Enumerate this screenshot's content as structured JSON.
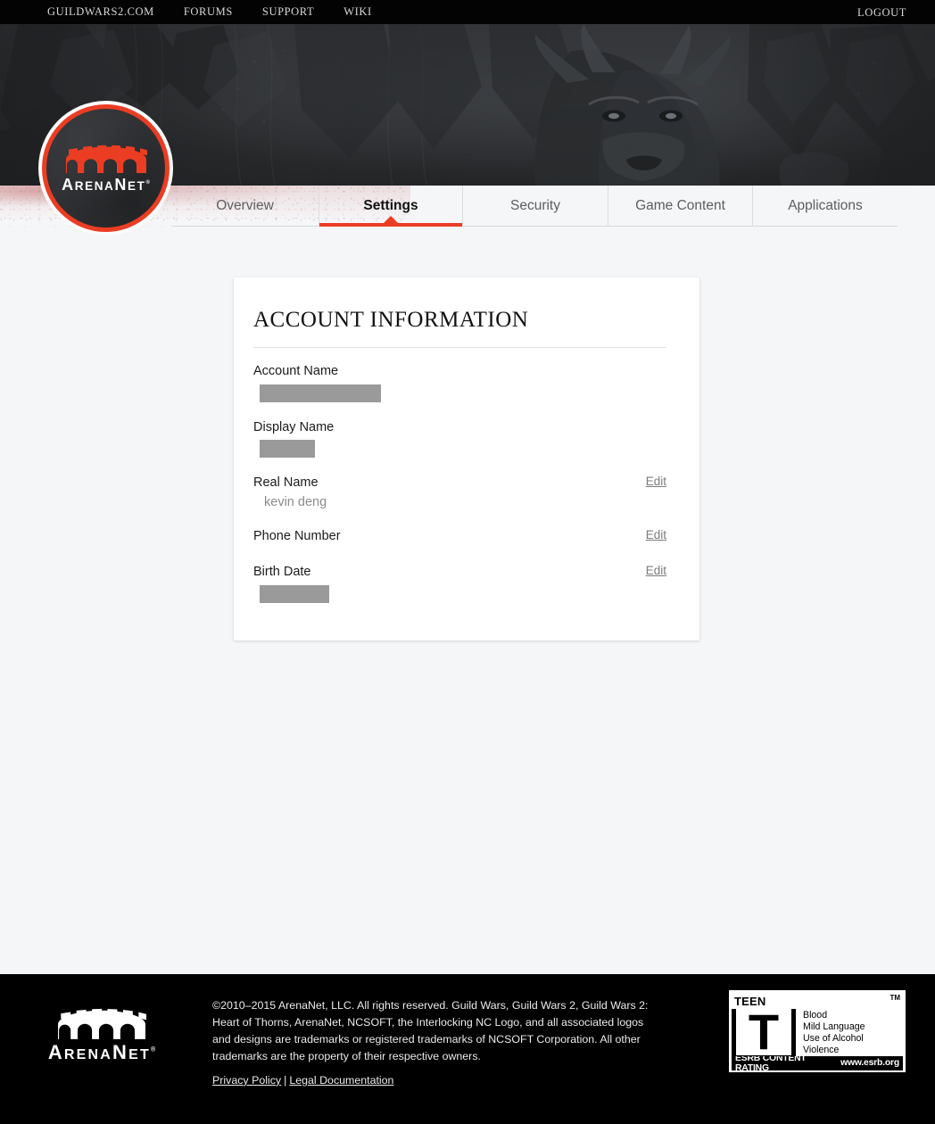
{
  "topnav": {
    "links": [
      {
        "label": "GUILDWARS2.COM",
        "name": "nav-link-guildwars2"
      },
      {
        "label": "FORUMS",
        "name": "nav-link-forums"
      },
      {
        "label": "SUPPORT",
        "name": "nav-link-support"
      },
      {
        "label": "WIKI",
        "name": "nav-link-wiki"
      }
    ],
    "logout_label": "LOGOUT"
  },
  "brand": {
    "name_upper": "A",
    "full": "ARENANET",
    "parts": {
      "a": "A",
      "rena": "RENA",
      "n": "N",
      "et": "ET"
    },
    "trademark": "®",
    "accent_color": "#eb3d23"
  },
  "tabs": [
    {
      "label": "Overview",
      "active": false,
      "name": "tab-overview"
    },
    {
      "label": "Settings",
      "active": true,
      "name": "tab-settings"
    },
    {
      "label": "Security",
      "active": false,
      "name": "tab-security"
    },
    {
      "label": "Game Content",
      "active": false,
      "name": "tab-game-content"
    },
    {
      "label": "Applications",
      "active": false,
      "name": "tab-applications"
    }
  ],
  "card": {
    "title": "ACCOUNT INFORMATION",
    "fields": [
      {
        "label": "Account Name",
        "value": "",
        "redacted": true,
        "edit": false,
        "edit_label": ""
      },
      {
        "label": "Display Name",
        "value": "",
        "redacted": true,
        "edit": false,
        "edit_label": ""
      },
      {
        "label": "Real Name",
        "value": "kevin deng",
        "redacted": false,
        "edit": true,
        "edit_label": "Edit"
      },
      {
        "label": "Phone Number",
        "value": "",
        "redacted": false,
        "edit": true,
        "edit_label": "Edit"
      },
      {
        "label": "Birth Date",
        "value": "",
        "redacted": true,
        "edit": true,
        "edit_label": "Edit"
      }
    ]
  },
  "footer": {
    "copyright": "©2010–2015 ArenaNet, LLC. All rights reserved. Guild Wars, Guild Wars 2, Guild Wars 2: Heart of Thorns, ArenaNet, NCSOFT, the Interlocking NC Logo, and all associated logos and designs are trademarks or registered trademarks of NCSOFT Corporation. All other trademarks are the property of their respective owners.",
    "privacy_label": "Privacy Policy",
    "separator": "|",
    "legal_label": "Legal Documentation"
  },
  "esrb": {
    "rating_word": "TEEN",
    "rating_letter": "T",
    "tm": "TM",
    "descriptors": [
      "Blood",
      "Mild Language",
      "Use of Alcohol",
      "Violence"
    ],
    "footer_left": "ESRB CONTENT RATING",
    "footer_right": "www.esrb.org"
  },
  "colors": {
    "accent": "#eb3d23",
    "page_bg": "#f5f6f8",
    "card_bg": "#ffffff",
    "nav_bg": "#030303",
    "redact": "#9a9a9a"
  }
}
